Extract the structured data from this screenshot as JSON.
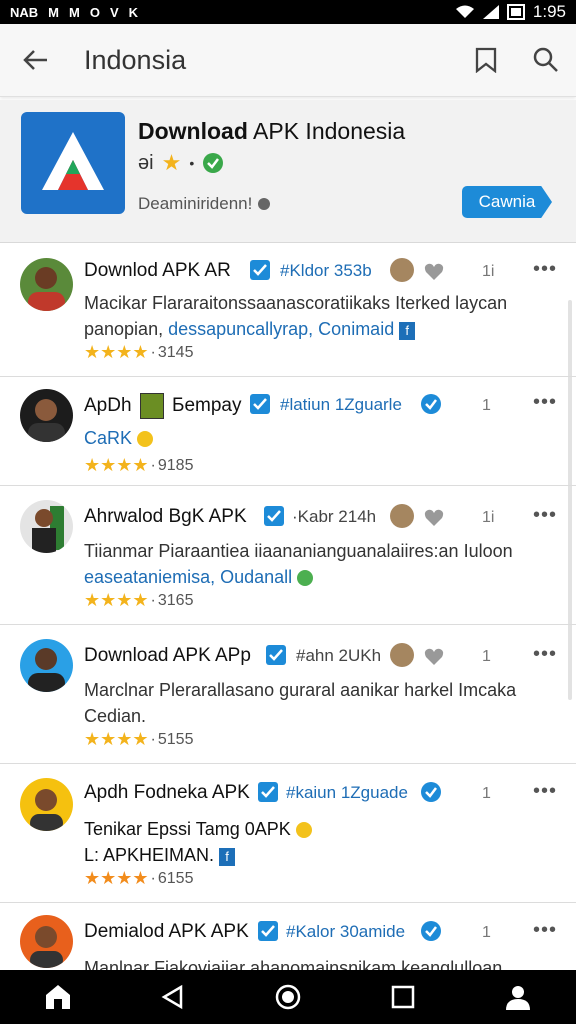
{
  "status": {
    "icons_left": [
      "NAB",
      "M",
      "M",
      "O",
      "V",
      "K"
    ],
    "time": "1:95"
  },
  "appbar": {
    "title": "Indonsia"
  },
  "app": {
    "name_bold": "Download",
    "name_rest": " APK Indonesia",
    "rating_text": "ǝi",
    "developer": "Deaminiridenn!",
    "button": "Cawnia",
    "brand_color": "#1f72c8"
  },
  "items": [
    {
      "name": "Downlod APK AR",
      "meta": "#Kldor 353b",
      "count": "1i",
      "desc1": "Macikar Flararaitonssaanascoratiikaks Iterked laycan",
      "desc2a": "panopian, ",
      "desc2b": "dessapuncallyrap, Conimaid",
      "rating": "3145",
      "avatar_bg": "#4c7a2c"
    },
    {
      "name": "ApDh",
      "name2": "Бempay",
      "meta": "#latiun 1Zguarle",
      "count": "1",
      "desc1": "CaRK",
      "rating": "9185",
      "avatar_bg": "#1c1c1c"
    },
    {
      "name": "Ahrwalod BgK APK",
      "meta": "·Kabr 214h",
      "count": "1i",
      "desc1": "Tiianmar Piaraantiea iiaananianguanalaiires:an Iuloon",
      "desc2b": "easeataniemisa, Oudanall",
      "rating": "3165",
      "avatar_bg": "#dddddd"
    },
    {
      "name": "Download APK APp",
      "meta": "#ahn 2UKh",
      "count": "1",
      "desc1": "Marclnar Plerarallasano guraral aanikar harkel Imcaka",
      "desc2a": "Cedian.",
      "rating": "5155",
      "avatar_bg": "#2aa0e6"
    },
    {
      "name": "Apdh Fodneka APK",
      "meta": "#kaiun 1Zguade",
      "count": "1",
      "desc1": "Tenikar Epssi Tamg 0APK",
      "desc2a": "L: APKHEIMAN.",
      "rating": "6155",
      "avatar_bg": "#f5c10f"
    },
    {
      "name": "Demialod APK APK",
      "meta": "#Kalor 30amide",
      "count": "1",
      "desc1": "Manlnar Fiakoviajiar ahanomainsnikam keanglulloan",
      "avatar_bg": "#e8601c"
    }
  ]
}
